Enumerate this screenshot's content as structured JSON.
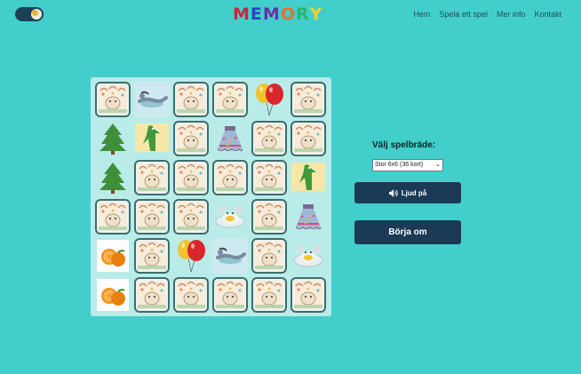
{
  "header": {
    "theme_toggle": {
      "icon": "moon-icon",
      "state": "dark-mode-off"
    },
    "logo_letters": [
      {
        "ch": "M",
        "color": "#c8263a"
      },
      {
        "ch": "E",
        "color": "#2a43b8"
      },
      {
        "ch": "M",
        "color": "#6b2fa6"
      },
      {
        "ch": "O",
        "color": "#e76f2a"
      },
      {
        "ch": "R",
        "color": "#2bb56b"
      },
      {
        "ch": "Y",
        "color": "#f1d32a"
      }
    ],
    "nav": [
      "Hem",
      "Spela ett spel",
      "Mer info",
      "Kontakt"
    ]
  },
  "board": {
    "cards": [
      "back",
      "lizard",
      "back",
      "back",
      "balloons",
      "back",
      "tree",
      "crocodile",
      "back",
      "skirt",
      "back",
      "back",
      "tree",
      "back",
      "back",
      "back",
      "back",
      "crocodile",
      "back",
      "back",
      "back",
      "egg",
      "back",
      "skirt",
      "orange",
      "back",
      "balloons",
      "lizard",
      "back",
      "egg",
      "orange",
      "back",
      "back",
      "back",
      "back",
      "back"
    ]
  },
  "panel": {
    "board_label": "Välj spelbräde:",
    "board_select_value": "Stor 6x6 (36 kort)",
    "sound_button": {
      "label": "Ljud på",
      "icon": "speaker-icon"
    },
    "restart_button": "Börja om"
  },
  "colors": {
    "background": "#42cfcb",
    "board": "#b9ece8",
    "button": "#1b3a55"
  }
}
